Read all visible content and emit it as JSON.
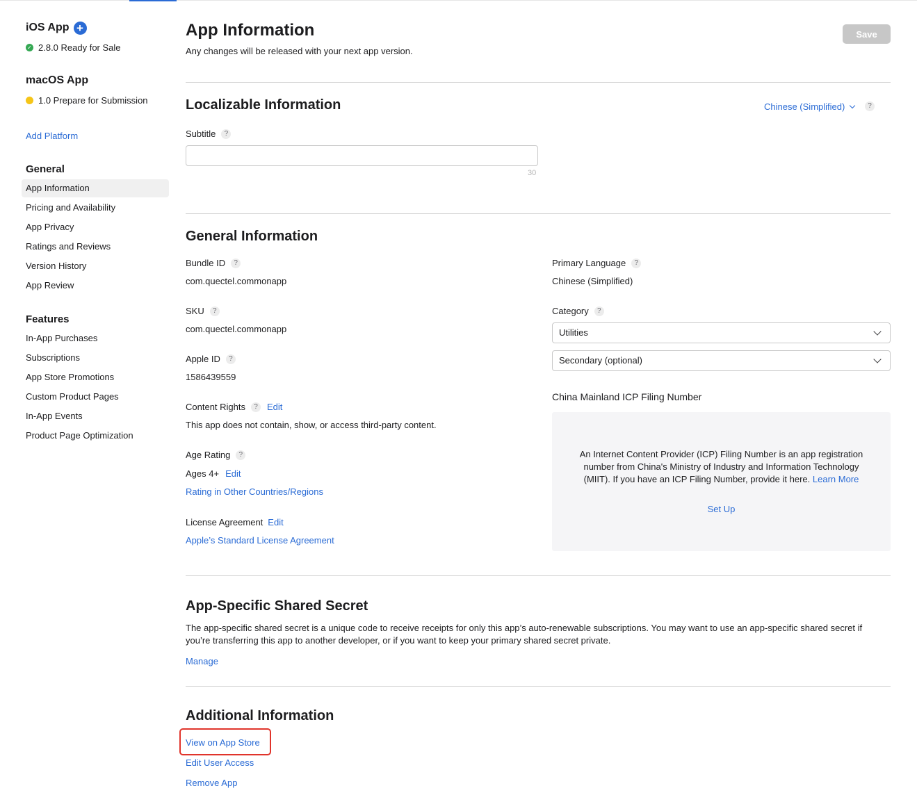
{
  "sidebar": {
    "platforms": [
      {
        "title": "iOS App",
        "add_label": "+",
        "status": "2.8.0 Ready for Sale",
        "status_color": "#34a853"
      },
      {
        "title": "macOS App",
        "status": "1.0 Prepare for Submission",
        "status_color": "#f5c518"
      }
    ],
    "add_platform": "Add Platform",
    "general": {
      "heading": "General",
      "items": [
        "App Information",
        "Pricing and Availability",
        "App Privacy",
        "Ratings and Reviews",
        "Version History",
        "App Review"
      ]
    },
    "features": {
      "heading": "Features",
      "items": [
        "In-App Purchases",
        "Subscriptions",
        "App Store Promotions",
        "Custom Product Pages",
        "In-App Events",
        "Product Page Optimization"
      ]
    }
  },
  "header": {
    "title": "App Information",
    "subtitle": "Any changes will be released with your next app version.",
    "save_label": "Save"
  },
  "localizable": {
    "title": "Localizable Information",
    "language": "Chinese (Simplified)",
    "help": "?",
    "subtitle_label": "Subtitle",
    "subtitle_value": "",
    "subtitle_counter": "30"
  },
  "general_info": {
    "title": "General Information",
    "bundle_id_label": "Bundle ID",
    "bundle_id": "com.quectel.commonapp",
    "sku_label": "SKU",
    "sku": "com.quectel.commonapp",
    "apple_id_label": "Apple ID",
    "apple_id": "1586439559",
    "content_rights_label": "Content Rights",
    "content_rights_edit": "Edit",
    "content_rights_text": "This app does not contain, show, or access third-party content.",
    "age_rating_label": "Age Rating",
    "age_rating": "Ages 4+",
    "age_rating_edit": "Edit",
    "rating_other": "Rating in Other Countries/Regions",
    "license_label": "License Agreement",
    "license_edit": "Edit",
    "license_link": "Apple’s Standard License Agreement",
    "primary_language_label": "Primary Language",
    "primary_language": "Chinese (Simplified)",
    "category_label": "Category",
    "category_primary": "Utilities",
    "category_secondary": "Secondary (optional)",
    "icp_title": "China Mainland ICP Filing Number",
    "icp_text": "An Internet Content Provider (ICP) Filing Number is an app registration number from China's Ministry of Industry and Information Technology (MIIT). If you have an ICP Filing Number, provide it here.",
    "icp_learn_more": "Learn More",
    "icp_setup": "Set Up"
  },
  "shared_secret": {
    "title": "App-Specific Shared Secret",
    "text": "The app-specific shared secret is a unique code to receive receipts for only this app’s auto-renewable subscriptions. You may want to use an app-specific shared secret if you’re transferring this app to another developer, or if you want to keep your primary shared secret private.",
    "manage": "Manage"
  },
  "additional": {
    "title": "Additional Information",
    "view_on_store": "View on App Store",
    "edit_user_access": "Edit User Access",
    "remove_app": "Remove App"
  },
  "colors": {
    "accent": "#2a6bd5",
    "highlight": "#e0342b"
  }
}
